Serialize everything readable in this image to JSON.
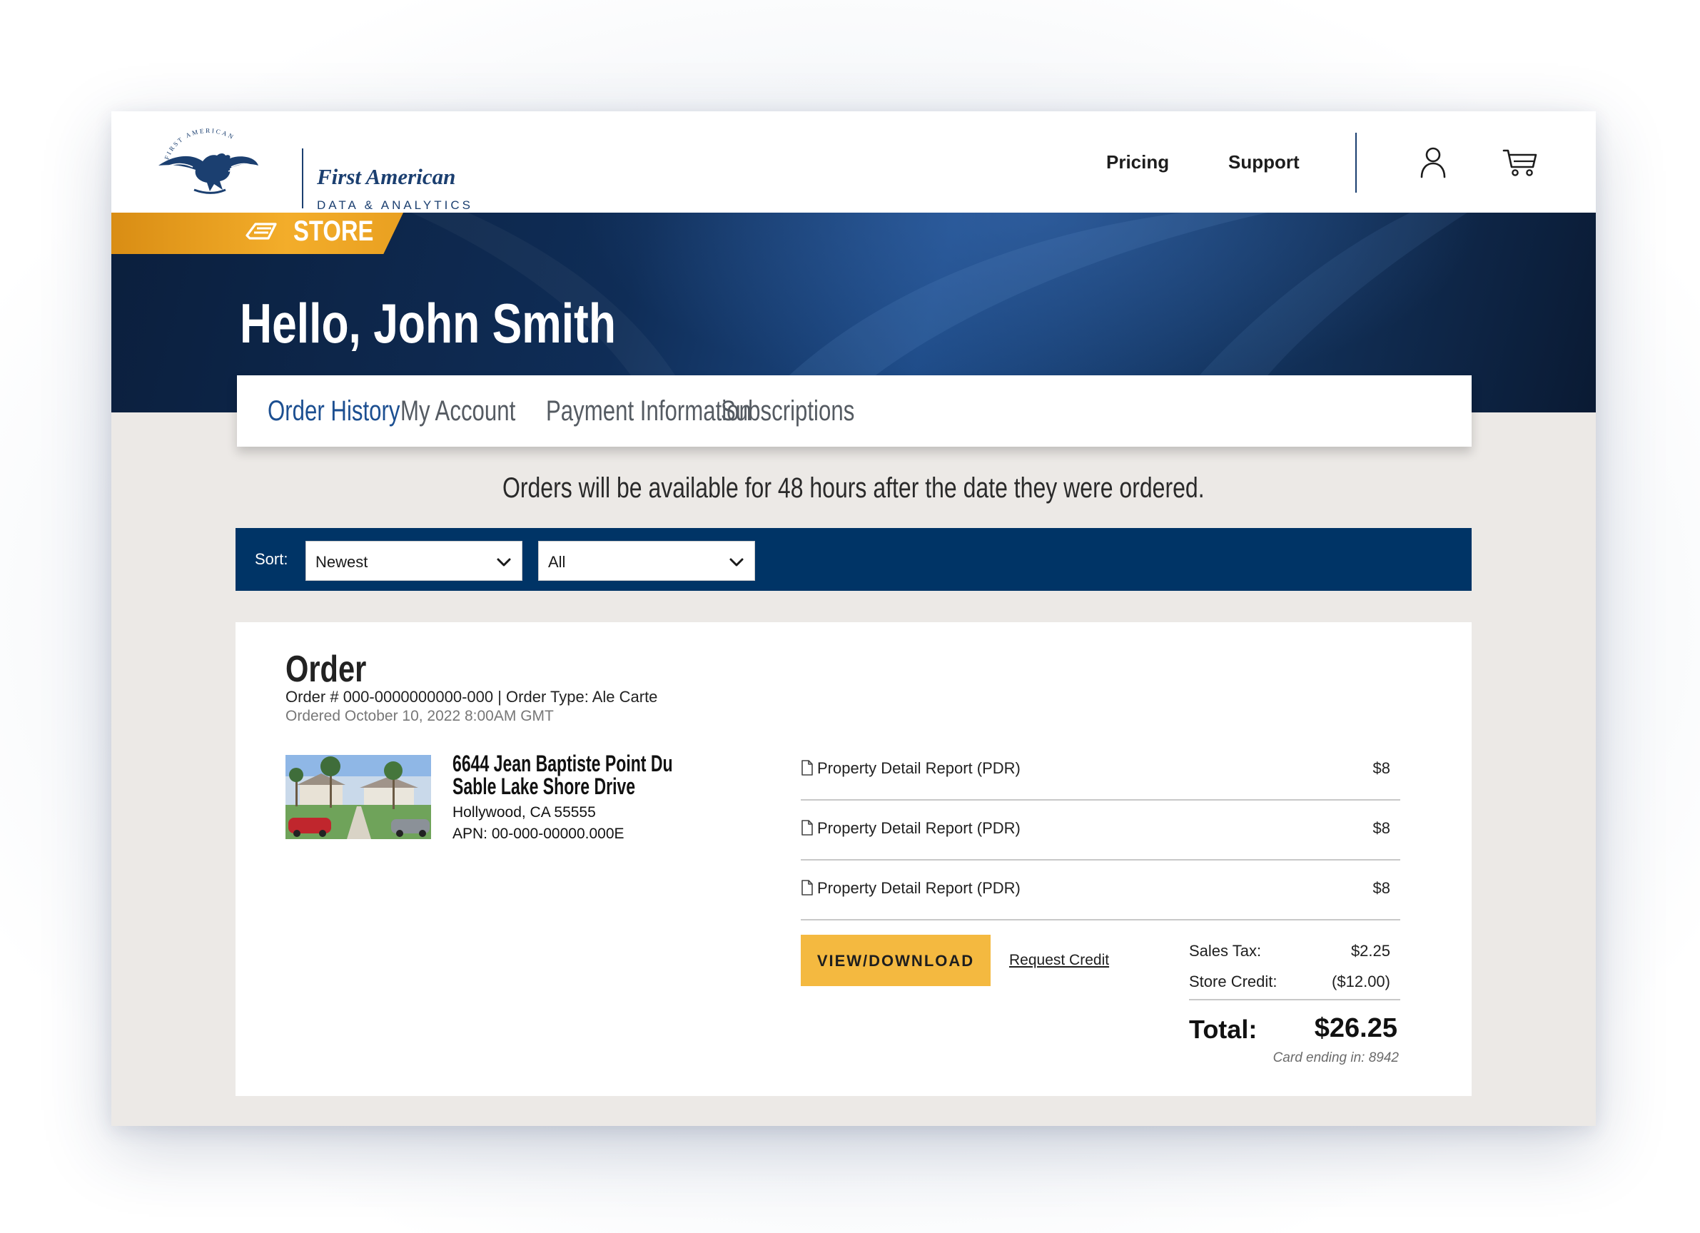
{
  "brand": {
    "name": "First American",
    "tagline": "DATA & ANALYTICS",
    "seal_text": "FIRST AMERICAN",
    "primary_color": "#1b3f70"
  },
  "topnav": {
    "links": [
      "Pricing",
      "Support"
    ],
    "icons": [
      "user-icon",
      "cart-icon"
    ]
  },
  "hero": {
    "store_label": "STORE",
    "greeting": "Hello, John Smith",
    "store_tab_color": "#f3ad2a"
  },
  "tabs": {
    "items": [
      {
        "label": "Order History",
        "active": true
      },
      {
        "label": "My Account",
        "active": false
      },
      {
        "label": "Payment Information",
        "active": false
      },
      {
        "label": "Subscriptions",
        "active": false
      }
    ],
    "active_color": "#1c4f91"
  },
  "notice": "Orders will be available for 48 hours after the date they were ordered.",
  "filters": {
    "sort_label": "Sort:",
    "sort_value": "Newest",
    "type_value": "All",
    "bar_color": "#003466"
  },
  "order": {
    "title": "Order",
    "meta": "Order # 000-0000000000-000   |   Order Type: Ale Carte",
    "date": "Ordered October 10, 2022 8:00AM GMT",
    "address_line1": "6644 Jean Baptiste Point Du",
    "address_line2": "Sable Lake Shore Drive",
    "city": "Hollywood, CA 55555",
    "apn": "APN: 00-000-00000.000E",
    "items": [
      {
        "name": "Property Detail Report (PDR)",
        "price": "$8"
      },
      {
        "name": "Property Detail Report (PDR)",
        "price": "$8"
      },
      {
        "name": "Property Detail Report (PDR)",
        "price": "$8"
      }
    ],
    "download_label": "VIEW/DOWNLOAD",
    "request_credit_label": "Request Credit",
    "sales_tax_label": "Sales Tax:",
    "sales_tax_value": "$2.25",
    "store_credit_label": "Store Credit:",
    "store_credit_value": "($12.00)",
    "total_label": "Total:",
    "total_value": "$26.25",
    "card_ending": "Card ending in: 8942",
    "button_color": "#f4b940"
  }
}
